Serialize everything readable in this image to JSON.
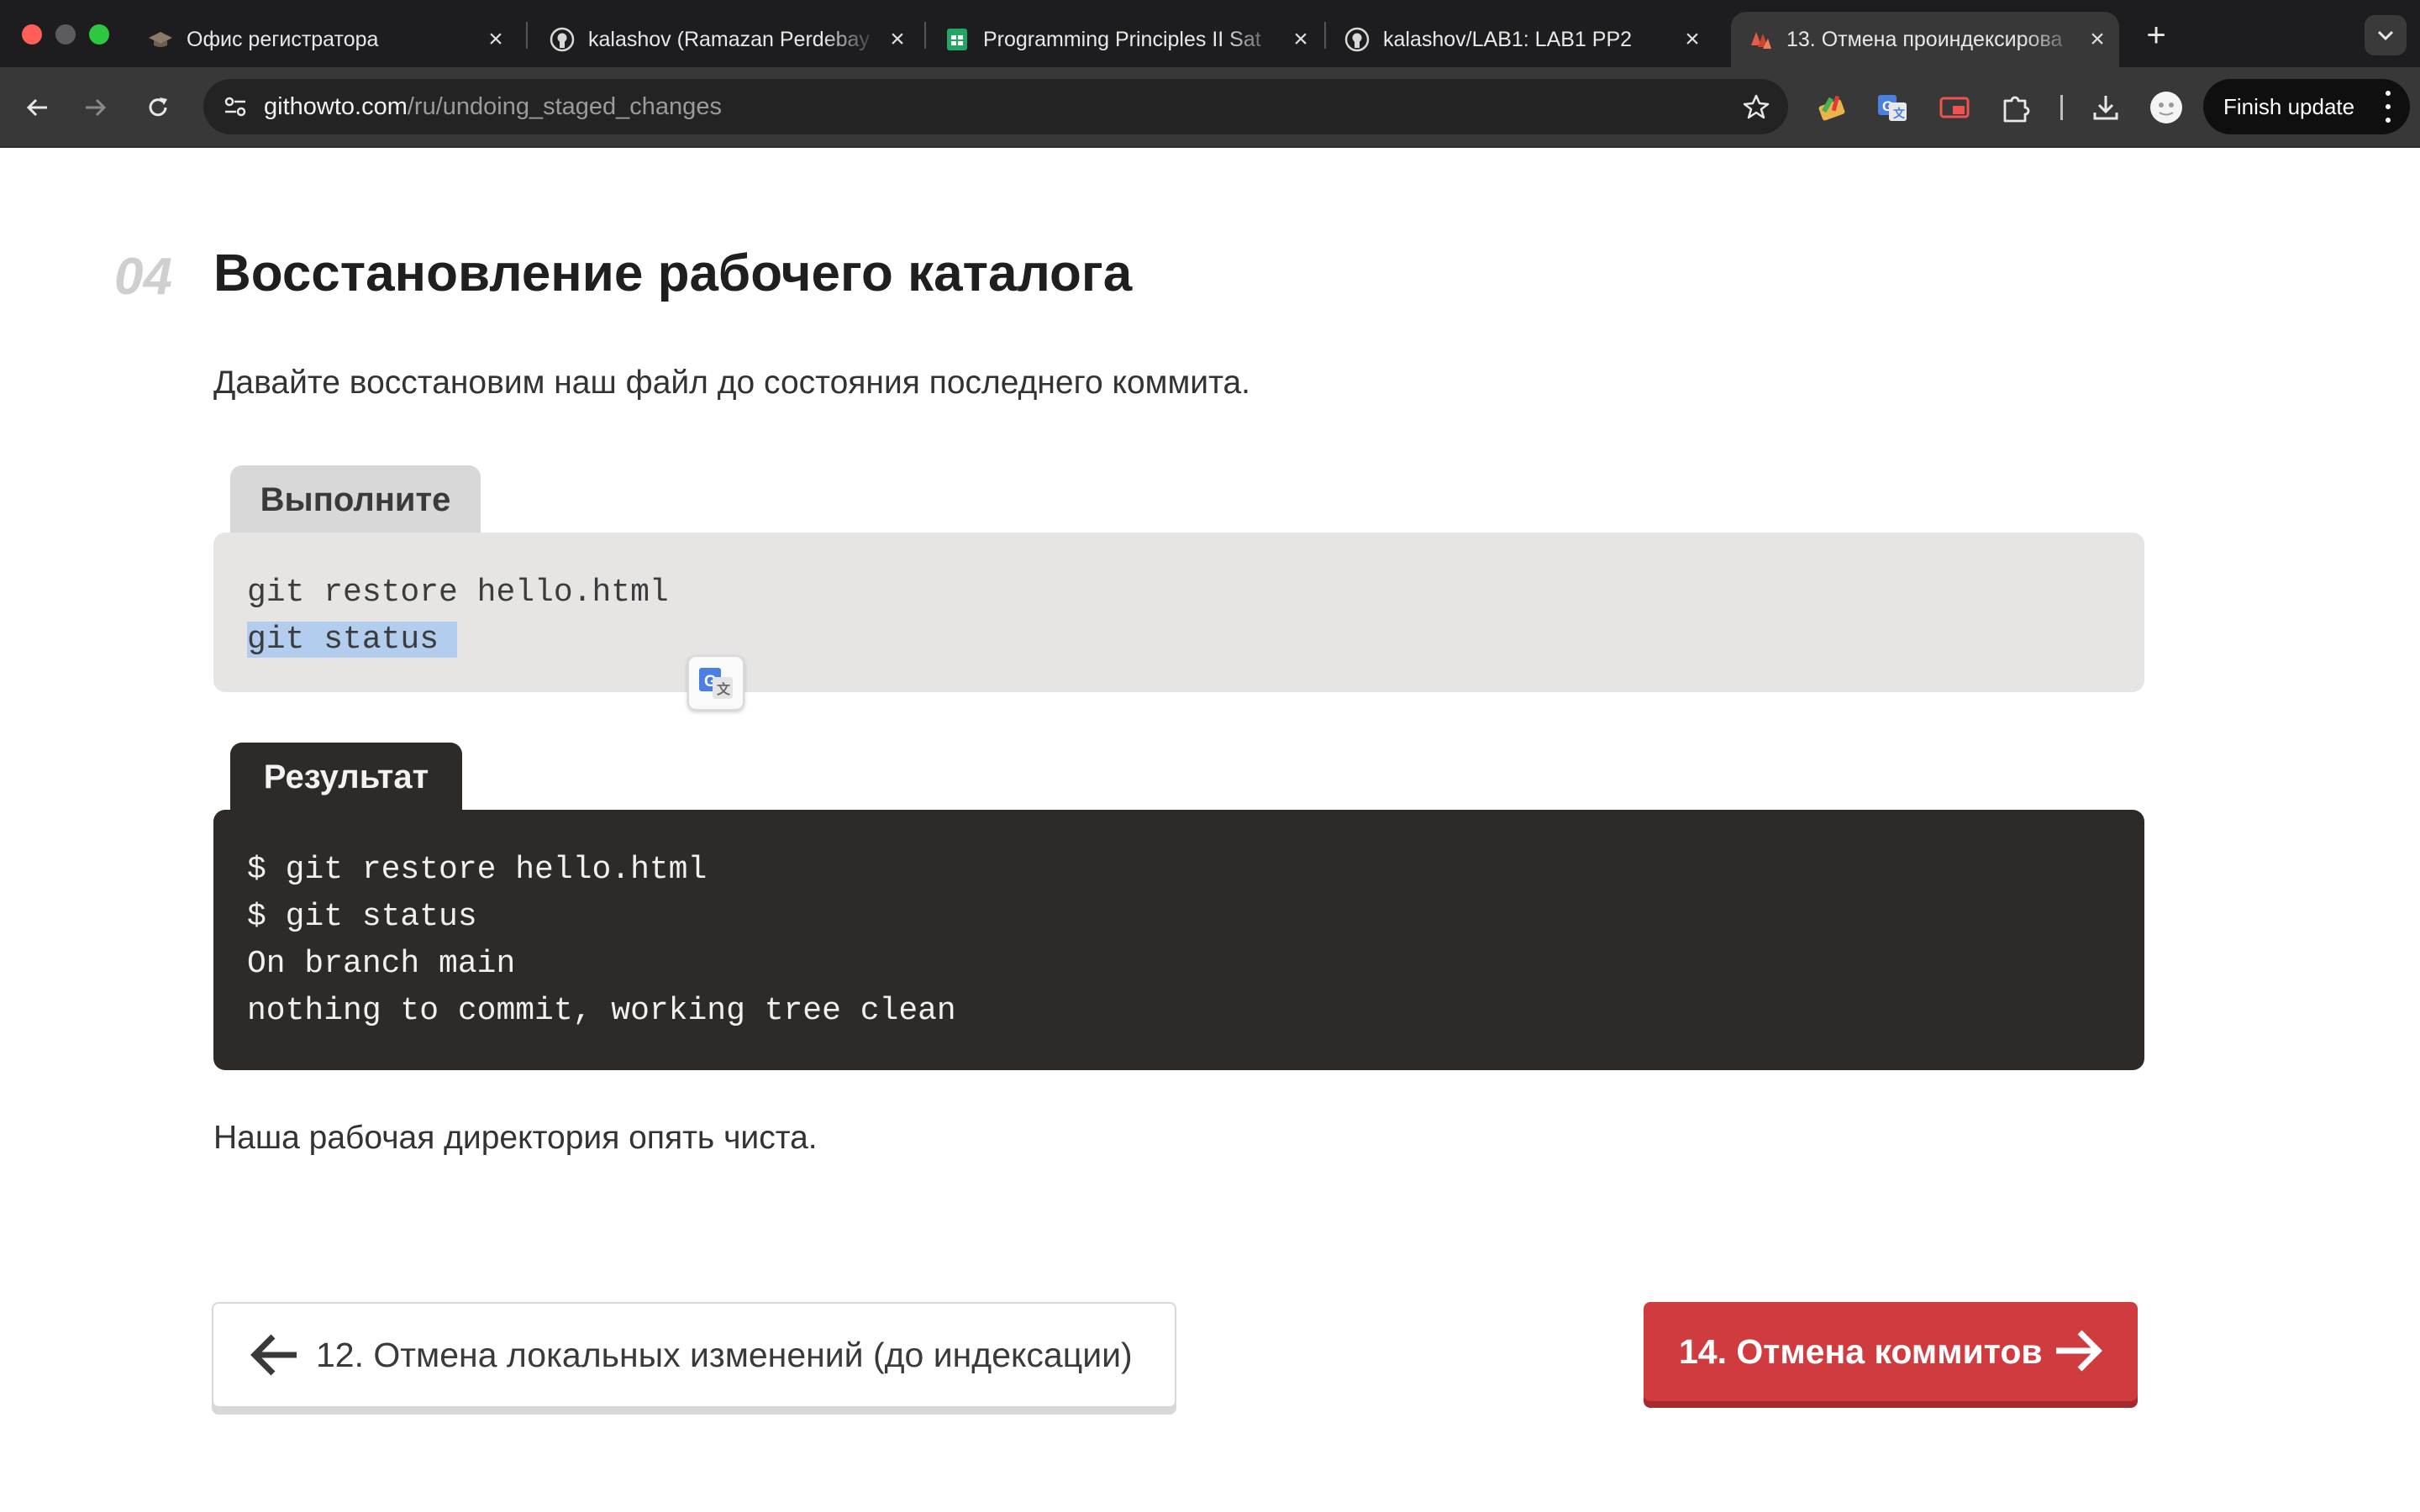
{
  "browser": {
    "tabs": [
      {
        "title": "Офис регистратора",
        "icon": "graduation-cap-icon"
      },
      {
        "title": "kalashov (Ramazan Perdebay",
        "icon": "github-icon"
      },
      {
        "title": "Programming Principles II Sat",
        "icon": "google-sheets-icon"
      },
      {
        "title": "kalashov/LAB1: LAB1 PP2",
        "icon": "github-icon"
      },
      {
        "title": "13. Отмена проиндексирова",
        "icon": "git-icon",
        "active": true
      }
    ],
    "url_host": "githowto.com",
    "url_path": "/ru/undoing_staged_changes",
    "finish_update_label": "Finish update"
  },
  "page": {
    "step_number": "04",
    "step_title": "Восстановление рабочего каталога",
    "intro": "Давайте восстановим наш файл до состояния последнего коммита.",
    "run_label": "Выполните",
    "run_lines": [
      "git restore hello.html",
      "git status"
    ],
    "result_label": "Результат",
    "result_lines": [
      "$ git restore hello.html",
      "$ git status",
      "On branch main",
      "nothing to commit, working tree clean"
    ],
    "outro": "Наша рабочая директория опять чиста.",
    "prev_label": "12. Отмена локальных изменений (до индексации)",
    "next_label": "14. Отмена коммитов"
  },
  "colors": {
    "accent_red": "#cf3b3e",
    "terminal_bg": "#2d2a28",
    "code_bg": "#e6e5e4",
    "selection": "#b3cdef"
  }
}
